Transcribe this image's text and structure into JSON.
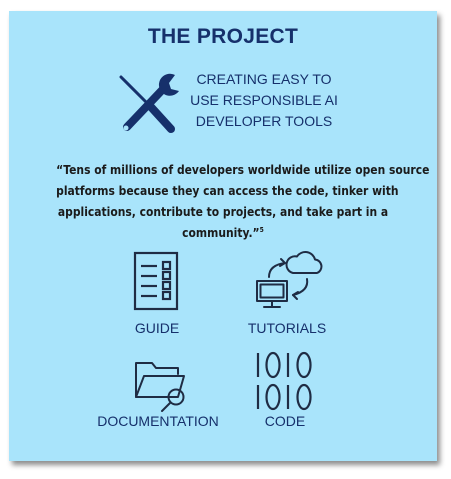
{
  "title": "THE PROJECT",
  "subtitle": {
    "line1": "CREATING EASY TO",
    "line2": "USE RESPONSIBLE AI",
    "line3": "DEVELOPER TOOLS"
  },
  "quote": {
    "line1": "“Tens of millions of developers worldwide utilize open source",
    "line2": "platforms because they can access the code, tinker with",
    "line3": "applications, contribute to projects, and take part in a",
    "line4": "community.”",
    "footnote": "5"
  },
  "items": [
    {
      "label": "GUIDE",
      "icon": "checklist-icon"
    },
    {
      "label": "TUTORIALS",
      "icon": "computer-cloud-sync-icon"
    },
    {
      "label": "DOCUMENTATION",
      "icon": "folder-search-icon"
    },
    {
      "label": "CODE",
      "icon": "binary-code-icon"
    }
  ],
  "colors": {
    "background": "#a9e4fb",
    "title": "#16306b",
    "icon_dark": "#16306b",
    "icon_line": "#1f2c44",
    "quote_text": "#1b1b1b"
  }
}
